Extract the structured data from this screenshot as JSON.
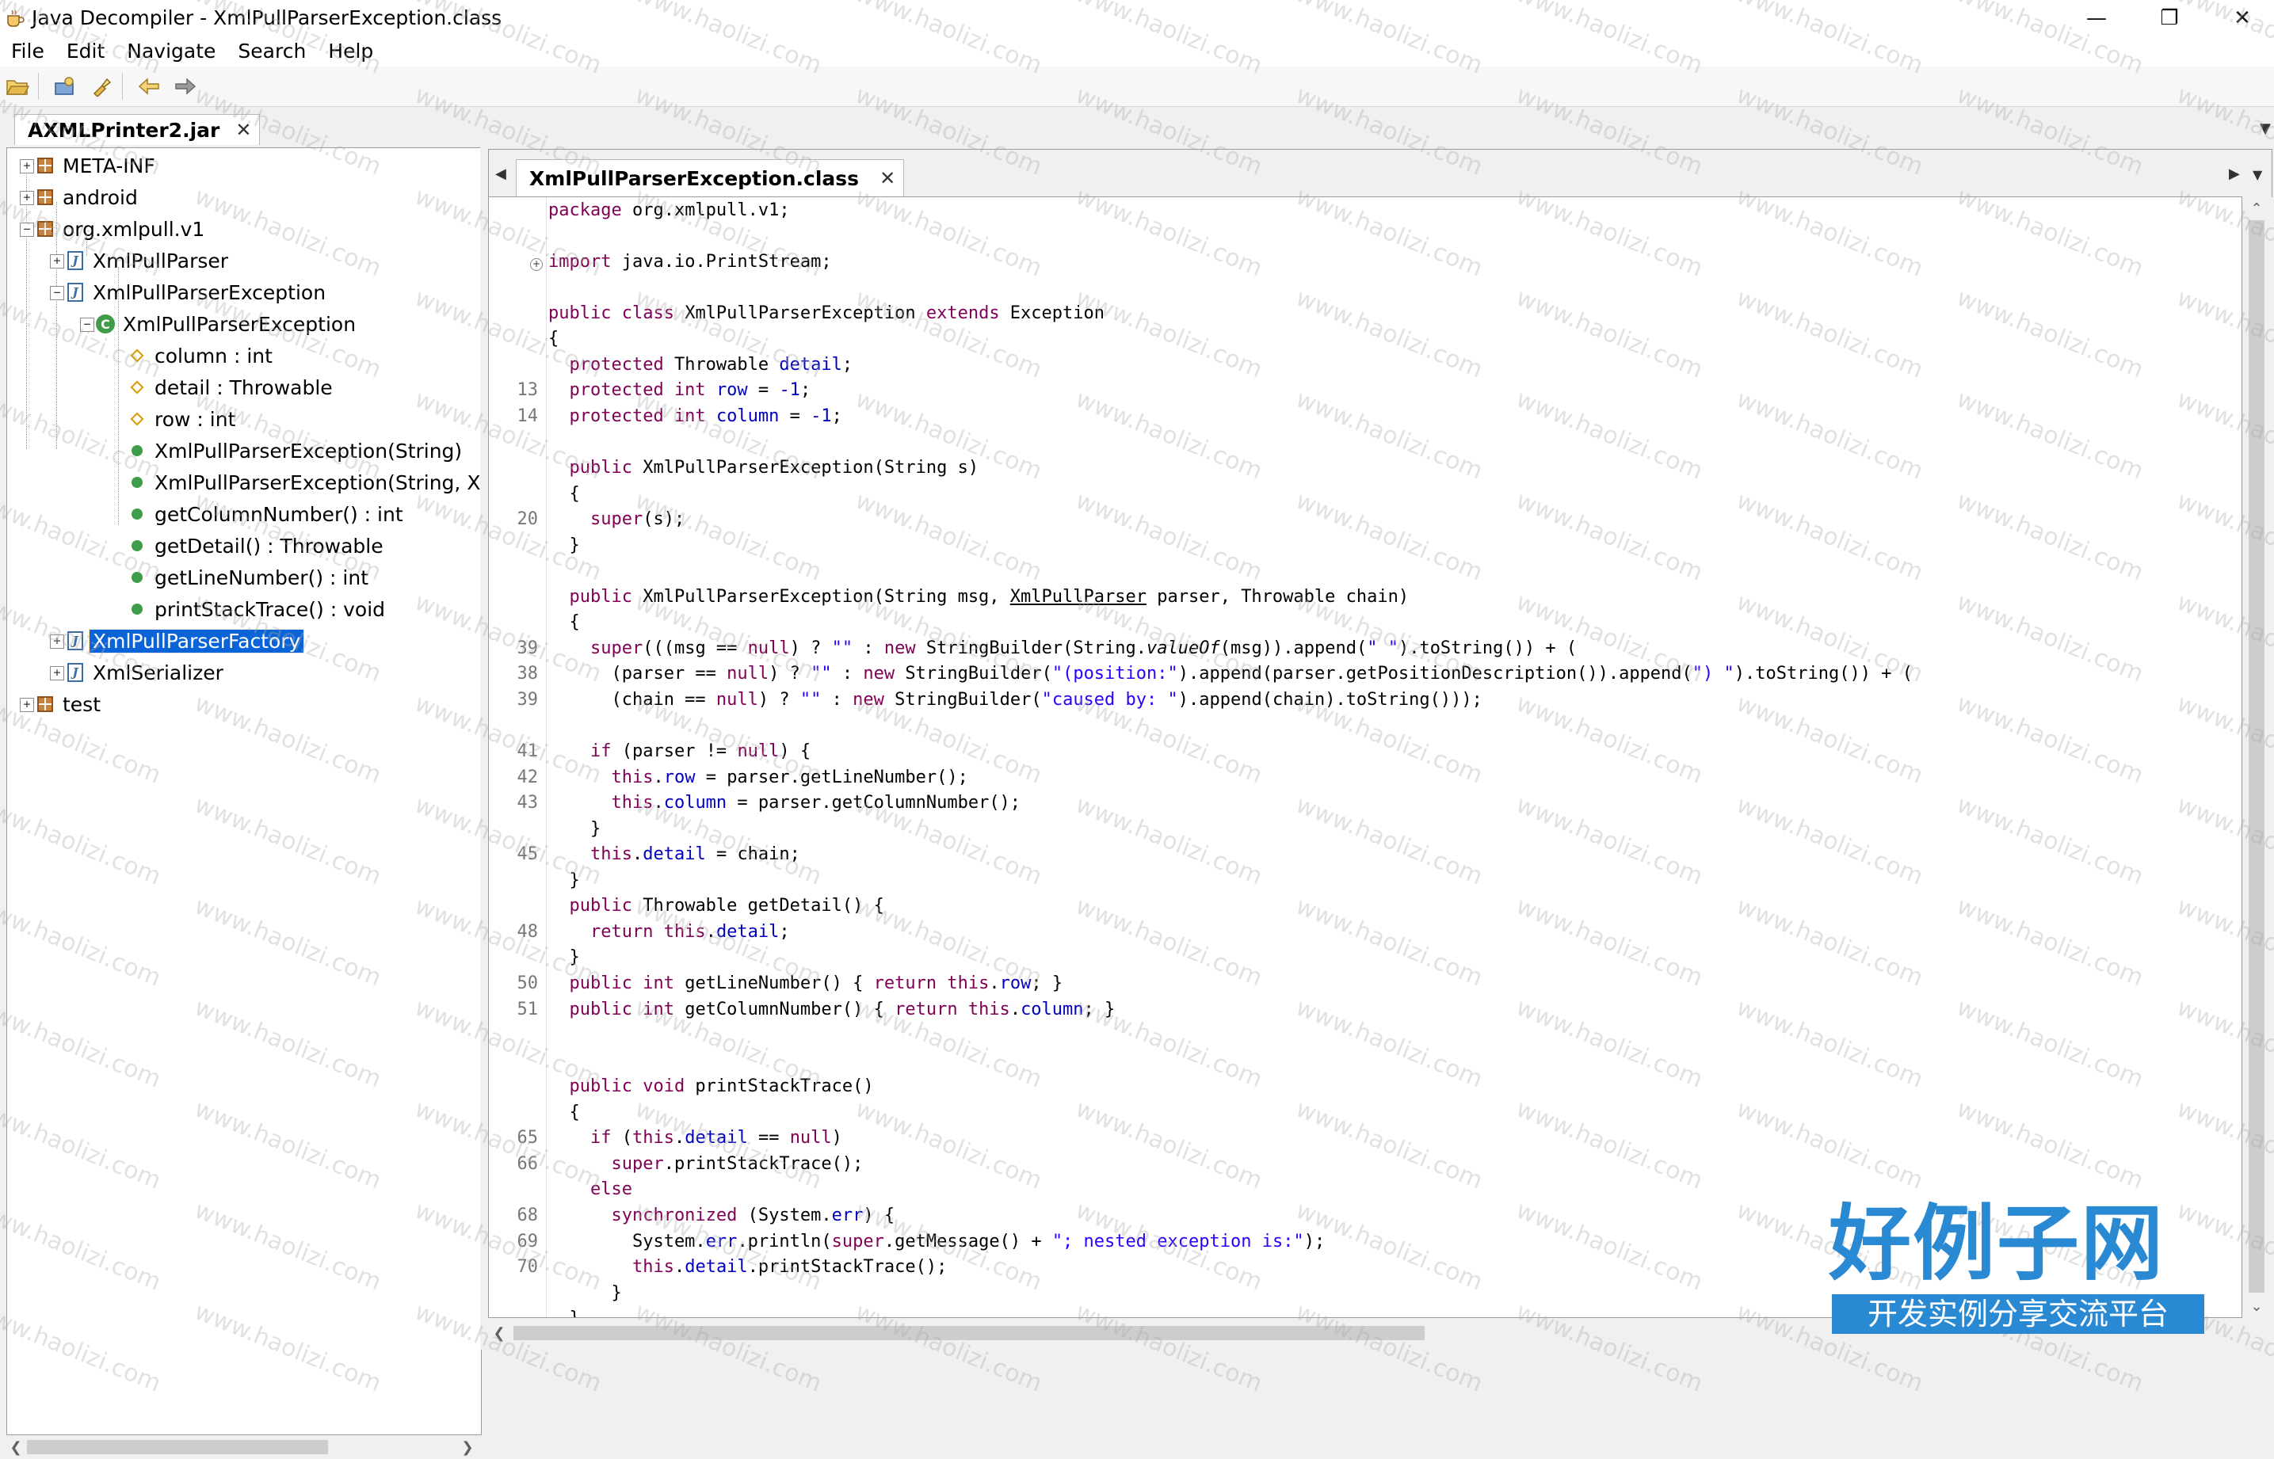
{
  "window": {
    "title": "Java Decompiler - XmlPullParserException.class"
  },
  "menu": [
    "File",
    "Edit",
    "Navigate",
    "Search",
    "Help"
  ],
  "left_tab": {
    "label": "AXMLPrinter2.jar"
  },
  "tree": [
    "META-INF",
    "android",
    "org.xmlpull.v1",
    "XmlPullParser",
    "XmlPullParserException",
    "XmlPullParserException",
    "column : int",
    "detail : Throwable",
    "row : int",
    "XmlPullParserException(String)",
    "XmlPullParserException(String, Xm",
    "getColumnNumber() : int",
    "getDetail() : Throwable",
    "getLineNumber() : int",
    "printStackTrace() : void",
    "XmlPullParserFactory",
    "XmlSerializer",
    "test"
  ],
  "editor_tab": {
    "label": "XmlPullParserException.class"
  },
  "line_numbers": [
    "13",
    "14",
    "20",
    "39",
    "38",
    "39",
    "41",
    "42",
    "43",
    "45",
    "48",
    "50",
    "51",
    "65",
    "66",
    "68",
    "69",
    "70"
  ],
  "code": {
    "l1": [
      "package org.xmlpull.v1;"
    ],
    "l2": [
      "import java.io.PrintStream;"
    ],
    "l3": [
      "public class",
      " XmlPullParserException ",
      "extends",
      " Exception"
    ],
    "l4": [
      "{"
    ],
    "l5": [
      "  protected",
      " Throwable ",
      "detail",
      ";"
    ],
    "l6": [
      "  protected int",
      " ",
      "row",
      " = ",
      "-1",
      ";"
    ],
    "l7": [
      "  protected int",
      " ",
      "column",
      " = ",
      "-1",
      ";"
    ],
    "l8": [
      "  public",
      " XmlPullParserException(String s)"
    ],
    "l9": [
      "  {"
    ],
    "l10": [
      "    super",
      "(s);"
    ],
    "l11": [
      "  }"
    ],
    "l12": [
      "  public",
      " XmlPullParserException(String msg, ",
      "XmlPullParser",
      " parser, Throwable chain)"
    ],
    "l13": [
      "  {"
    ],
    "l14": [
      "    super",
      "(((msg == ",
      "null",
      ") ? ",
      "\"\"",
      " : ",
      "new",
      " StringBuilder(String.",
      "valueOf",
      "(msg)).append(",
      "\" \"",
      ").toString()) + ("
    ],
    "l15": [
      "      (parser == ",
      "null",
      ") ? ",
      "\"\"",
      " : ",
      "new",
      " StringBuilder(",
      "\"(position:\"",
      ").append(parser.getPositionDescription()).append(",
      "\") \"",
      ").toString()) + ("
    ],
    "l16": [
      "      (chain == ",
      "null",
      ") ? ",
      "\"\"",
      " : ",
      "new",
      " StringBuilder(",
      "\"caused by: \"",
      ").append(chain).toString()));"
    ],
    "l17": [
      "    if",
      " (parser != ",
      "null",
      ") {"
    ],
    "l18": [
      "      this",
      ".",
      "row",
      " = parser.getLineNumber();"
    ],
    "l19": [
      "      this",
      ".",
      "column",
      " = parser.getColumnNumber();"
    ],
    "l20": [
      "    }"
    ],
    "l21": [
      "    this",
      ".",
      "detail",
      " = chain;"
    ],
    "l22": [
      "  }"
    ],
    "l23": [
      "  public",
      " Throwable getDetail() {"
    ],
    "l24": [
      "    return this",
      ".",
      "detail",
      ";"
    ],
    "l25": [
      "  }"
    ],
    "l26": [
      "  public int",
      " getLineNumber() { ",
      "return this",
      ".",
      "row",
      "; }"
    ],
    "l27": [
      "  public int",
      " getColumnNumber() { ",
      "return this",
      ".",
      "column",
      "; }"
    ],
    "l28": [
      "  public void",
      " printStackTrace()"
    ],
    "l29": [
      "  {"
    ],
    "l30": [
      "    if",
      " (",
      "this",
      ".",
      "detail",
      " == ",
      "null",
      ")"
    ],
    "l31": [
      "      super",
      ".printStackTrace();"
    ],
    "l32": [
      "    else"
    ],
    "l33": [
      "      synchronized",
      " (System.",
      "err",
      ") {"
    ],
    "l34": [
      "        System.",
      "err",
      ".println(",
      "super",
      ".getMessage() + ",
      "\"; nested exception is:\"",
      ");"
    ],
    "l35": [
      "        this",
      ".",
      "detail",
      ".printStackTrace();"
    ],
    "l36": [
      "      }"
    ],
    "l37": [
      "  }"
    ]
  },
  "watermark": "www.haolizi.com",
  "brand": {
    "main": "好例子网",
    "sub": "开发实例分享交流平台"
  },
  "colors": {
    "keyword": "#7f0055",
    "field": "#0000c0",
    "string": "#2a00ff",
    "selection": "#0a64d8",
    "brand": "#2a89d3"
  }
}
